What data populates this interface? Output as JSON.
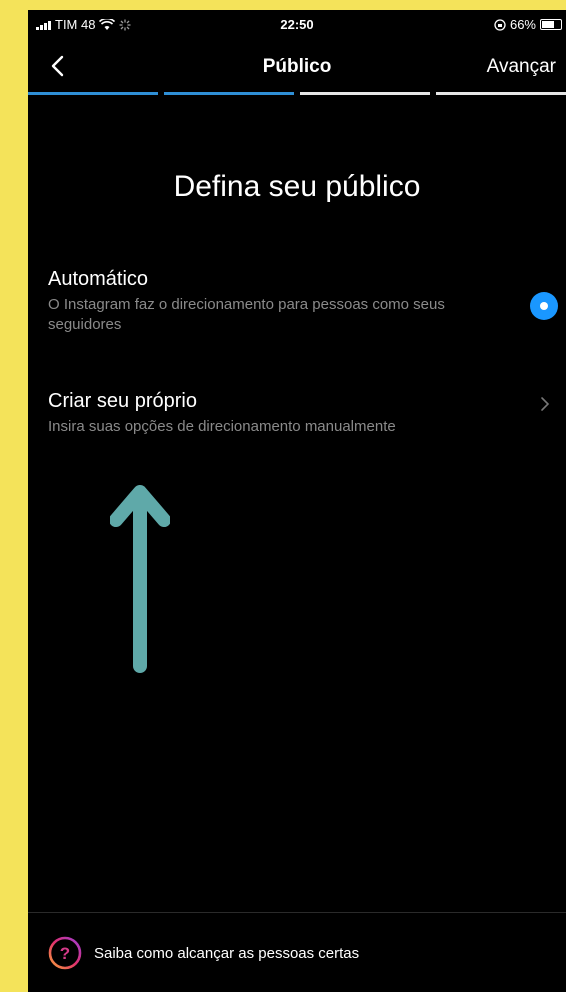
{
  "status_bar": {
    "carrier": "TIM 48",
    "time": "22:50",
    "battery": "66%",
    "battery_level": 0.66
  },
  "nav": {
    "title": "Público",
    "next_label": "Avançar",
    "progress_segments": [
      true,
      true,
      false,
      false
    ]
  },
  "heading": "Defina seu público",
  "options": [
    {
      "title": "Automático",
      "description": "O Instagram faz o direcionamento para pessoas como seus seguidores",
      "selected": true
    },
    {
      "title": "Criar seu próprio",
      "description": "Insira suas opções de direcionamento manualmente",
      "selected": false
    }
  ],
  "footer": {
    "text": "Saiba como alcançar as pessoas certas"
  },
  "colors": {
    "accent": "#1a97ff",
    "progress": "#2f8fd6",
    "annotation_arrow": "#5fa9a9",
    "frame": "#f4e35a"
  }
}
